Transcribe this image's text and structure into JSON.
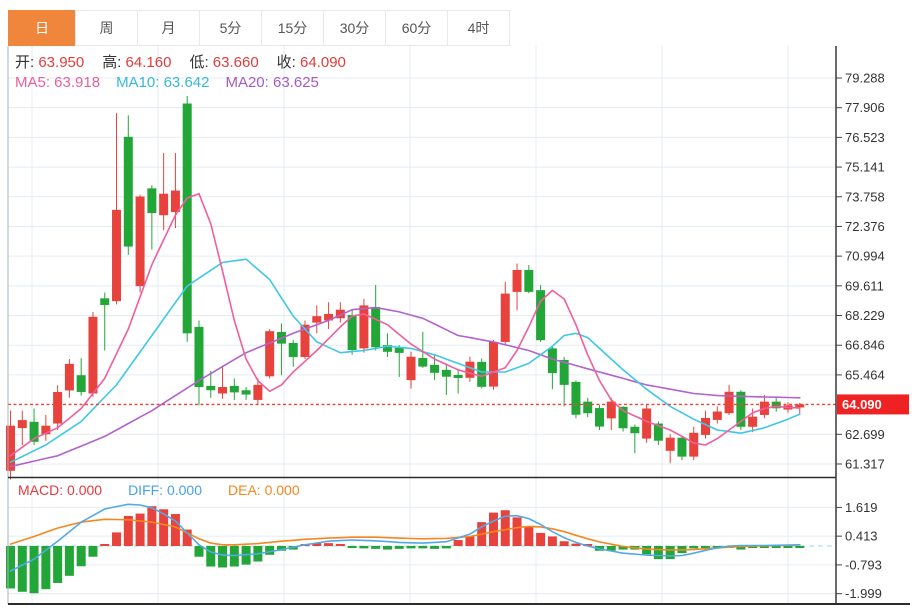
{
  "tabs": {
    "items": [
      {
        "label": "日",
        "active": true
      },
      {
        "label": "周",
        "active": false
      },
      {
        "label": "月",
        "active": false
      },
      {
        "label": "5分",
        "active": false
      },
      {
        "label": "15分",
        "active": false
      },
      {
        "label": "30分",
        "active": false
      },
      {
        "label": "60分",
        "active": false
      },
      {
        "label": "4时",
        "active": false
      }
    ]
  },
  "legend": {
    "ohlc": [
      {
        "label": "开:",
        "value": "63.950"
      },
      {
        "label": "高:",
        "value": "64.160"
      },
      {
        "label": "低:",
        "value": "63.660"
      },
      {
        "label": "收:",
        "value": "64.090"
      }
    ],
    "ohlc_value_color": "#e23b3b",
    "ma": [
      {
        "label": "MA5:",
        "value": "63.918",
        "color": "#ea5f9d"
      },
      {
        "label": "MA10:",
        "value": "63.642",
        "color": "#35b9d6"
      },
      {
        "label": "MA20:",
        "value": "63.625",
        "color": "#a55bc4"
      }
    ]
  },
  "macd_legend": [
    {
      "label": "MACD:",
      "value": "0.000",
      "color": "#e8393c"
    },
    {
      "label": "DIFF:",
      "value": "0.000",
      "color": "#46a2e8"
    },
    {
      "label": "DEA:",
      "value": "0.000",
      "color": "#f5861f"
    }
  ],
  "price_axis": {
    "ticks": [
      "79.288",
      "77.906",
      "76.523",
      "75.141",
      "73.758",
      "72.376",
      "70.994",
      "69.611",
      "68.229",
      "66.846",
      "65.464",
      "62.699",
      "61.317"
    ],
    "current_price": "64.090"
  },
  "macd_axis": {
    "ticks": [
      "1.619",
      "0.413",
      "-0.793",
      "-1.999"
    ]
  },
  "colors": {
    "up": "#e8423c",
    "down": "#23a638",
    "ma5": "#ef5f9e",
    "ma10": "#3fc8e6",
    "ma20": "#b263cc",
    "diff_line": "#53a9e8",
    "dea_line": "#f5871f",
    "grid": "#e4ecf3",
    "axis_line": "#2b2b2b",
    "left_border": "#a9b4bd",
    "current_line": "#f44336",
    "current_badge": "#ee2222",
    "zero_dash": "#9fd9ee"
  },
  "chart_data": {
    "type": "candlestick+macd",
    "title": "Daily K-line with MA5/MA10/MA20 and MACD",
    "price_range": [
      61.317,
      79.288
    ],
    "macd_range": [
      -1.999,
      1.619
    ],
    "current_price_value": 64.09,
    "candles": [
      [
        61.0,
        63.8,
        60.6,
        63.1
      ],
      [
        62.99,
        63.8,
        62.2,
        63.36
      ],
      [
        63.28,
        63.9,
        62.2,
        62.35
      ],
      [
        62.7,
        63.6,
        62.4,
        63.1
      ],
      [
        63.2,
        64.98,
        62.9,
        64.67
      ],
      [
        64.74,
        66.2,
        64.4,
        65.98
      ],
      [
        65.45,
        66.24,
        64.5,
        64.67
      ],
      [
        64.6,
        68.4,
        64.45,
        68.17
      ],
      [
        69.03,
        69.3,
        66.6,
        68.72
      ],
      [
        68.9,
        77.65,
        68.75,
        73.15
      ],
      [
        76.55,
        77.55,
        71.05,
        71.44
      ],
      [
        69.6,
        73.85,
        69.3,
        73.77
      ],
      [
        74.15,
        74.3,
        71.3,
        73.0
      ],
      [
        72.9,
        75.8,
        72.2,
        73.9
      ],
      [
        73.05,
        75.8,
        72.3,
        74.05
      ],
      [
        78.1,
        78.45,
        67.0,
        67.4
      ],
      [
        67.7,
        68.0,
        64.05,
        64.9
      ],
      [
        64.95,
        65.65,
        64.4,
        64.75
      ],
      [
        64.6,
        65.9,
        64.35,
        64.9
      ],
      [
        64.95,
        65.3,
        64.3,
        64.65
      ],
      [
        64.75,
        64.9,
        64.3,
        64.55
      ],
      [
        64.3,
        65.3,
        64.1,
        65.0
      ],
      [
        65.4,
        67.6,
        65.3,
        67.5
      ],
      [
        67.46,
        67.86,
        65.45,
        66.92
      ],
      [
        66.95,
        67.1,
        65.84,
        66.3
      ],
      [
        66.3,
        68.0,
        66.2,
        67.8
      ],
      [
        67.9,
        68.7,
        67.4,
        68.2
      ],
      [
        68.0,
        68.85,
        67.6,
        68.3
      ],
      [
        68.1,
        68.85,
        67.9,
        68.5
      ],
      [
        68.25,
        68.5,
        66.4,
        66.62
      ],
      [
        66.7,
        69.0,
        66.5,
        68.7
      ],
      [
        68.63,
        69.65,
        66.6,
        66.75
      ],
      [
        66.85,
        67.4,
        66.3,
        66.54
      ],
      [
        66.72,
        66.85,
        65.37,
        66.49
      ],
      [
        65.22,
        66.54,
        64.83,
        66.31
      ],
      [
        66.25,
        67.47,
        65.79,
        65.85
      ],
      [
        65.93,
        66.38,
        65.23,
        65.56
      ],
      [
        65.7,
        66.0,
        64.53,
        65.38
      ],
      [
        65.46,
        65.7,
        64.6,
        65.32
      ],
      [
        65.33,
        66.31,
        65.14,
        66.08
      ],
      [
        66.07,
        66.23,
        64.83,
        64.91
      ],
      [
        64.92,
        67.08,
        64.77,
        67.0
      ],
      [
        67.0,
        69.8,
        66.9,
        69.25
      ],
      [
        69.33,
        70.65,
        68.47,
        70.35
      ],
      [
        70.35,
        70.58,
        69.27,
        69.33
      ],
      [
        69.41,
        69.64,
        67.0,
        67.08
      ],
      [
        66.7,
        66.8,
        64.8,
        65.55
      ],
      [
        66.16,
        66.3,
        64.0,
        65.0
      ],
      [
        65.14,
        65.2,
        63.44,
        63.61
      ],
      [
        64.22,
        64.4,
        63.5,
        63.68
      ],
      [
        63.92,
        64.06,
        62.9,
        63.06
      ],
      [
        63.44,
        64.4,
        62.9,
        64.22
      ],
      [
        63.98,
        64.0,
        62.83,
        62.98
      ],
      [
        63.05,
        63.15,
        61.82,
        62.75
      ],
      [
        62.5,
        64.1,
        62.3,
        63.9
      ],
      [
        63.2,
        63.3,
        62.2,
        62.4
      ],
      [
        61.93,
        62.7,
        61.35,
        62.54
      ],
      [
        62.54,
        62.6,
        61.5,
        61.66
      ],
      [
        61.66,
        63.05,
        61.5,
        62.77
      ],
      [
        62.67,
        63.8,
        62.5,
        63.46
      ],
      [
        63.37,
        64.0,
        63.2,
        63.76
      ],
      [
        63.68,
        65.0,
        63.6,
        64.68
      ],
      [
        64.68,
        64.75,
        62.9,
        63.05
      ],
      [
        63.05,
        63.9,
        62.8,
        63.52
      ],
      [
        63.6,
        64.53,
        63.45,
        64.22
      ],
      [
        64.22,
        64.4,
        63.75,
        63.91
      ],
      [
        63.85,
        64.2,
        63.7,
        64.05
      ],
      [
        63.95,
        64.16,
        63.66,
        64.09
      ]
    ],
    "macd_hist": [
      -1.78,
      -1.92,
      -1.98,
      -1.81,
      -1.55,
      -1.25,
      -0.85,
      -0.45,
      0.06,
      0.57,
      1.26,
      1.36,
      1.67,
      1.54,
      1.34,
      0.69,
      -0.45,
      -0.86,
      -0.9,
      -0.86,
      -0.78,
      -0.65,
      -0.37,
      -0.2,
      -0.15,
      0.08,
      0.12,
      0.12,
      0.08,
      -0.08,
      -0.1,
      -0.12,
      -0.15,
      -0.12,
      -0.1,
      -0.1,
      -0.12,
      -0.1,
      0.25,
      0.4,
      1.0,
      1.4,
      1.5,
      1.2,
      0.8,
      0.55,
      0.4,
      0.2,
      0.1,
      0.08,
      -0.2,
      -0.2,
      -0.15,
      -0.15,
      -0.35,
      -0.55,
      -0.55,
      -0.3,
      -0.1,
      -0.05,
      -0.03,
      -0.02,
      -0.15,
      -0.05,
      -0.03,
      -0.02,
      -0.02,
      -0.02
    ],
    "diff_keypoints": [
      [
        0,
        -1.05
      ],
      [
        2,
        -0.55
      ],
      [
        4,
        0.2
      ],
      [
        6,
        1.0
      ],
      [
        8,
        1.55
      ],
      [
        10,
        1.75
      ],
      [
        11,
        1.72
      ],
      [
        12,
        1.6
      ],
      [
        13,
        1.35
      ],
      [
        14,
        1.05
      ],
      [
        15,
        0.55
      ],
      [
        16,
        0.05
      ],
      [
        17,
        -0.25
      ],
      [
        18,
        -0.38
      ],
      [
        19,
        -0.4
      ],
      [
        21,
        -0.33
      ],
      [
        23,
        -0.15
      ],
      [
        25,
        0.05
      ],
      [
        27,
        0.2
      ],
      [
        29,
        0.25
      ],
      [
        31,
        0.22
      ],
      [
        33,
        0.15
      ],
      [
        35,
        0.12
      ],
      [
        37,
        0.18
      ],
      [
        39,
        0.5
      ],
      [
        40,
        0.8
      ],
      [
        41,
        1.05
      ],
      [
        42,
        1.25
      ],
      [
        43,
        1.27
      ],
      [
        44,
        1.15
      ],
      [
        45,
        0.9
      ],
      [
        46,
        0.6
      ],
      [
        47,
        0.35
      ],
      [
        48,
        0.15
      ],
      [
        49,
        0.0
      ],
      [
        50,
        -0.12
      ],
      [
        52,
        -0.3
      ],
      [
        54,
        -0.38
      ],
      [
        56,
        -0.42
      ],
      [
        57,
        -0.4
      ],
      [
        58,
        -0.3
      ],
      [
        59,
        -0.18
      ],
      [
        60,
        -0.08
      ],
      [
        61,
        0.0
      ],
      [
        62,
        0.02
      ],
      [
        64,
        0.02
      ],
      [
        67,
        0.05
      ]
    ],
    "dea_keypoints": [
      [
        0,
        0.08
      ],
      [
        2,
        0.4
      ],
      [
        4,
        0.75
      ],
      [
        6,
        1.0
      ],
      [
        8,
        1.12
      ],
      [
        10,
        1.1
      ],
      [
        12,
        1.0
      ],
      [
        14,
        0.8
      ],
      [
        15,
        0.55
      ],
      [
        16,
        0.3
      ],
      [
        17,
        0.12
      ],
      [
        18,
        0.05
      ],
      [
        19,
        0.05
      ],
      [
        21,
        0.1
      ],
      [
        23,
        0.2
      ],
      [
        25,
        0.28
      ],
      [
        27,
        0.33
      ],
      [
        29,
        0.37
      ],
      [
        31,
        0.37
      ],
      [
        33,
        0.33
      ],
      [
        35,
        0.3
      ],
      [
        37,
        0.32
      ],
      [
        39,
        0.4
      ],
      [
        41,
        0.6
      ],
      [
        43,
        0.77
      ],
      [
        44,
        0.82
      ],
      [
        45,
        0.8
      ],
      [
        46,
        0.72
      ],
      [
        47,
        0.6
      ],
      [
        48,
        0.45
      ],
      [
        49,
        0.3
      ],
      [
        50,
        0.17
      ],
      [
        52,
        -0.02
      ],
      [
        54,
        -0.13
      ],
      [
        56,
        -0.17
      ],
      [
        58,
        -0.15
      ],
      [
        60,
        -0.08
      ],
      [
        62,
        -0.02
      ],
      [
        64,
        0.01
      ],
      [
        67,
        0.04
      ]
    ],
    "ma5_keypoints": [
      [
        0,
        61.7
      ],
      [
        2,
        62.5
      ],
      [
        4,
        63.0
      ],
      [
        6,
        63.9
      ],
      [
        8,
        65.3
      ],
      [
        10,
        67.6
      ],
      [
        12,
        70.6
      ],
      [
        14,
        72.9
      ],
      [
        15,
        73.7
      ],
      [
        16,
        73.9
      ],
      [
        17,
        72.5
      ],
      [
        18,
        70.3
      ],
      [
        19,
        68.0
      ],
      [
        20,
        66.2
      ],
      [
        21,
        65.2
      ],
      [
        22,
        64.7
      ],
      [
        23,
        65.0
      ],
      [
        24,
        65.6
      ],
      [
        26,
        66.6
      ],
      [
        28,
        67.7
      ],
      [
        29,
        68.2
      ],
      [
        30,
        68.3
      ],
      [
        32,
        67.8
      ],
      [
        34,
        66.9
      ],
      [
        36,
        66.2
      ],
      [
        38,
        65.7
      ],
      [
        40,
        65.4
      ],
      [
        42,
        65.8
      ],
      [
        43,
        66.6
      ],
      [
        44,
        67.7
      ],
      [
        45,
        68.9
      ],
      [
        46,
        69.4
      ],
      [
        47,
        69.0
      ],
      [
        48,
        67.8
      ],
      [
        49,
        66.4
      ],
      [
        50,
        65.2
      ],
      [
        51,
        64.3
      ],
      [
        52,
        63.8
      ],
      [
        54,
        63.3
      ],
      [
        56,
        62.9
      ],
      [
        58,
        62.3
      ],
      [
        59,
        62.2
      ],
      [
        60,
        62.5
      ],
      [
        61,
        62.9
      ],
      [
        62,
        63.3
      ],
      [
        63,
        63.7
      ],
      [
        64,
        63.9
      ],
      [
        65,
        64.0
      ],
      [
        66,
        63.95
      ],
      [
        67,
        63.92
      ]
    ],
    "ma10_keypoints": [
      [
        0,
        61.4
      ],
      [
        3,
        62.2
      ],
      [
        6,
        63.3
      ],
      [
        9,
        65.0
      ],
      [
        12,
        67.3
      ],
      [
        15,
        69.6
      ],
      [
        18,
        70.7
      ],
      [
        20,
        70.85
      ],
      [
        22,
        69.9
      ],
      [
        24,
        68.2
      ],
      [
        26,
        67.0
      ],
      [
        28,
        66.5
      ],
      [
        30,
        66.6
      ],
      [
        32,
        66.8
      ],
      [
        34,
        66.7
      ],
      [
        36,
        66.4
      ],
      [
        38,
        66.0
      ],
      [
        40,
        65.6
      ],
      [
        42,
        65.6
      ],
      [
        44,
        66.0
      ],
      [
        46,
        66.8
      ],
      [
        47,
        67.3
      ],
      [
        48,
        67.4
      ],
      [
        49,
        67.2
      ],
      [
        50,
        66.7
      ],
      [
        52,
        65.7
      ],
      [
        54,
        64.8
      ],
      [
        56,
        64.0
      ],
      [
        58,
        63.4
      ],
      [
        60,
        62.9
      ],
      [
        62,
        62.75
      ],
      [
        64,
        63.0
      ],
      [
        66,
        63.4
      ],
      [
        67,
        63.64
      ]
    ],
    "ma20_keypoints": [
      [
        0,
        61.2
      ],
      [
        4,
        61.7
      ],
      [
        8,
        62.6
      ],
      [
        12,
        63.8
      ],
      [
        16,
        65.2
      ],
      [
        20,
        66.5
      ],
      [
        24,
        67.4
      ],
      [
        27,
        68.0
      ],
      [
        29,
        68.5
      ],
      [
        31,
        68.6
      ],
      [
        33,
        68.4
      ],
      [
        35,
        68.1
      ],
      [
        38,
        67.3
      ],
      [
        41,
        67.0
      ],
      [
        44,
        66.6
      ],
      [
        46,
        66.2
      ],
      [
        48,
        65.9
      ],
      [
        50,
        65.6
      ],
      [
        52,
        65.3
      ],
      [
        54,
        65.0
      ],
      [
        56,
        64.8
      ],
      [
        58,
        64.6
      ],
      [
        60,
        64.5
      ],
      [
        63,
        64.45
      ],
      [
        67,
        64.4
      ]
    ]
  }
}
